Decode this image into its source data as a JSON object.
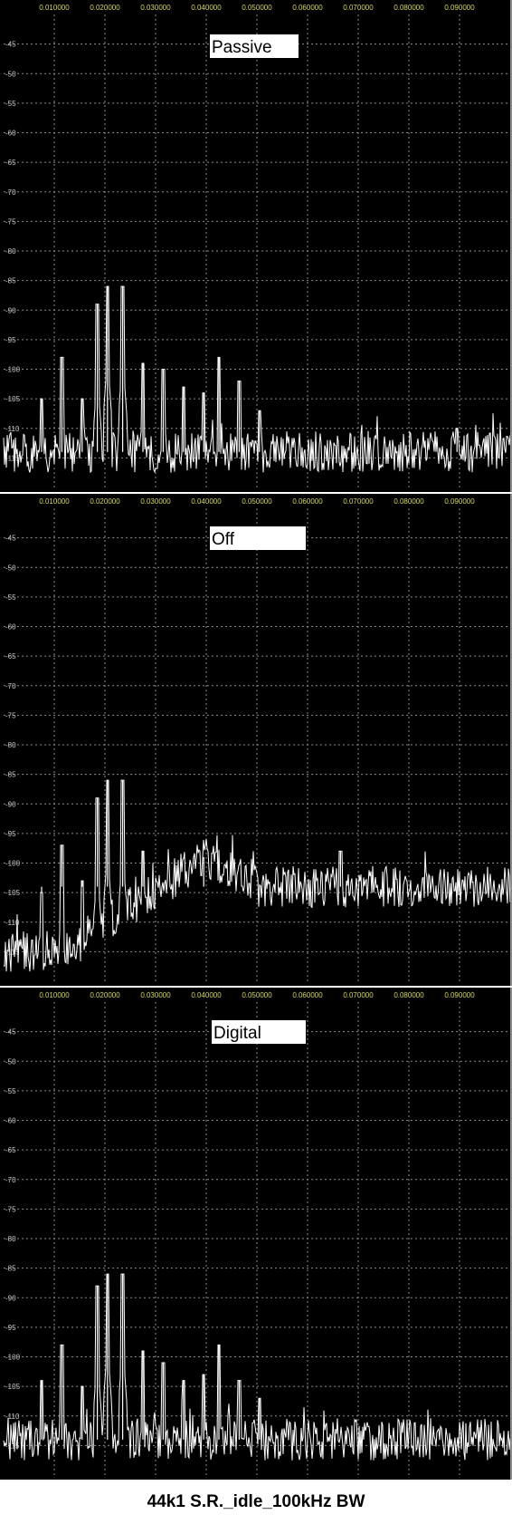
{
  "caption": "44k1 S.R._idle_100kHz BW",
  "colors": {
    "background": "#000000",
    "grid": "#8c8c8c",
    "trace": "#ffffff",
    "x_tick_text": "#d8d860",
    "y_tick_text": "#c8c8c8",
    "label_box": "#ffffff"
  },
  "chart_data": [
    {
      "type": "line",
      "label": "Passive",
      "xlim": [
        0,
        0.1
      ],
      "ylim": [
        -120,
        -40
      ],
      "x_ticks": [
        "0.010000",
        "0.020000",
        "0.030000",
        "0.040000",
        "0.050000",
        "0.060000",
        "0.070000",
        "0.080000",
        "0.090000"
      ],
      "y_ticks": [
        "-45",
        "-50",
        "-55",
        "-60",
        "-65",
        "-70",
        "-75",
        "-80",
        "-85",
        "-90",
        "-95",
        "-100",
        "-105",
        "-110",
        "-115"
      ],
      "grid": true,
      "noise_floor": -114,
      "noise_floor_profile": "flat",
      "peaks": [
        [
          0.0075,
          -105
        ],
        [
          0.0115,
          -98
        ],
        [
          0.0155,
          -105
        ],
        [
          0.0185,
          -89
        ],
        [
          0.0205,
          -86
        ],
        [
          0.0235,
          -86
        ],
        [
          0.0275,
          -99
        ],
        [
          0.0315,
          -100
        ],
        [
          0.0355,
          -103
        ],
        [
          0.0395,
          -104
        ],
        [
          0.0425,
          -98
        ],
        [
          0.0465,
          -102
        ],
        [
          0.0505,
          -107
        ],
        [
          0.0895,
          -110
        ]
      ]
    },
    {
      "type": "line",
      "label": "Off",
      "xlim": [
        0,
        0.1
      ],
      "ylim": [
        -120,
        -40
      ],
      "x_ticks": [
        "0.010000",
        "0.020000",
        "0.030000",
        "0.040000",
        "0.050000",
        "0.060000",
        "0.070000",
        "0.080000",
        "0.090000"
      ],
      "y_ticks": [
        "-45",
        "-50",
        "-55",
        "-60",
        "-65",
        "-70",
        "-75",
        "-80",
        "-85",
        "-90",
        "-95",
        "-100",
        "-105",
        "-110",
        "-115"
      ],
      "grid": true,
      "noise_floor": -104,
      "noise_floor_profile": "rising",
      "peaks": [
        [
          0.0075,
          -105
        ],
        [
          0.0115,
          -97
        ],
        [
          0.0155,
          -103
        ],
        [
          0.0185,
          -89
        ],
        [
          0.0205,
          -86
        ],
        [
          0.0235,
          -86
        ],
        [
          0.0275,
          -98
        ],
        [
          0.0395,
          -99
        ],
        [
          0.0665,
          -98
        ]
      ]
    },
    {
      "type": "line",
      "label": "Digital",
      "xlim": [
        0,
        0.1
      ],
      "ylim": [
        -120,
        -40
      ],
      "x_ticks": [
        "0.010000",
        "0.020000",
        "0.030000",
        "0.040000",
        "0.050000",
        "0.060000",
        "0.070000",
        "0.080000",
        "0.090000"
      ],
      "y_ticks": [
        "-45",
        "-50",
        "-55",
        "-60",
        "-65",
        "-70",
        "-75",
        "-80",
        "-85",
        "-90",
        "-95",
        "-100",
        "-105",
        "-110",
        "-115"
      ],
      "grid": true,
      "noise_floor": -114,
      "noise_floor_profile": "flat",
      "peaks": [
        [
          0.0075,
          -104
        ],
        [
          0.0115,
          -98
        ],
        [
          0.0155,
          -105
        ],
        [
          0.0185,
          -88
        ],
        [
          0.0205,
          -86
        ],
        [
          0.0235,
          -86
        ],
        [
          0.0275,
          -99
        ],
        [
          0.0315,
          -101
        ],
        [
          0.0355,
          -104
        ],
        [
          0.0395,
          -103
        ],
        [
          0.0425,
          -98
        ],
        [
          0.0465,
          -104
        ],
        [
          0.0505,
          -107
        ]
      ]
    }
  ]
}
